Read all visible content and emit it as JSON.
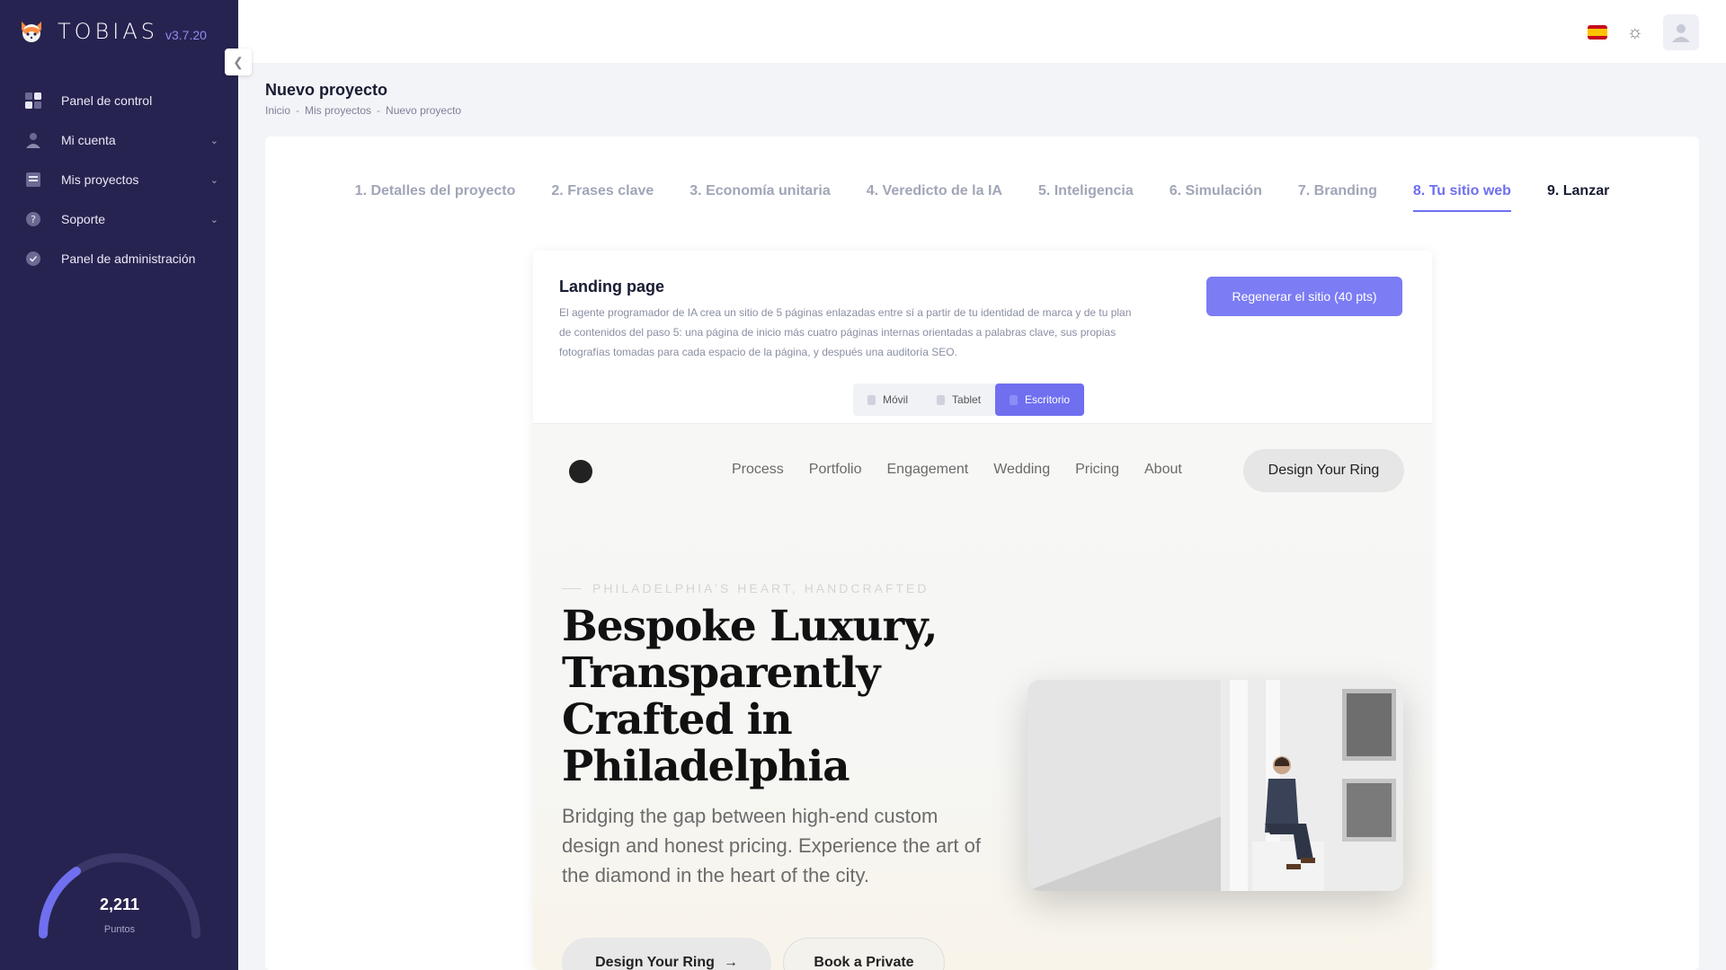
{
  "app": {
    "name": "TOBIAS",
    "version": "v3.7.20"
  },
  "sidebar": {
    "items": [
      {
        "label": "Panel de control",
        "icon": "dashboard-icon",
        "expandable": false
      },
      {
        "label": "Mi cuenta",
        "icon": "user-icon",
        "expandable": true
      },
      {
        "label": "Mis proyectos",
        "icon": "projects-icon",
        "expandable": true
      },
      {
        "label": "Soporte",
        "icon": "help-icon",
        "expandable": true
      },
      {
        "label": "Panel de administración",
        "icon": "shield-icon",
        "expandable": false
      }
    ],
    "points": {
      "value": "2,211",
      "label": "Puntos",
      "fill_fraction": 0.3
    }
  },
  "topbar": {
    "language": "es",
    "theme_icon": "sun-icon",
    "user_icon": "user-avatar-icon"
  },
  "page": {
    "title": "Nuevo proyecto",
    "breadcrumb": [
      "Inicio",
      "Mis proyectos",
      "Nuevo proyecto"
    ]
  },
  "steps": [
    {
      "label": "1. Detalles del proyecto",
      "state": "done"
    },
    {
      "label": "2. Frases clave",
      "state": "done"
    },
    {
      "label": "3. Economía unitaria",
      "state": "done"
    },
    {
      "label": "4. Veredicto de la IA",
      "state": "done"
    },
    {
      "label": "5. Inteligencia",
      "state": "done"
    },
    {
      "label": "6. Simulación",
      "state": "done"
    },
    {
      "label": "7. Branding",
      "state": "done"
    },
    {
      "label": "8. Tu sitio web",
      "state": "active"
    },
    {
      "label": "9. Lanzar",
      "state": "next"
    }
  ],
  "landing": {
    "title": "Landing page",
    "description": "El agente programador de IA crea un sitio de 5 páginas enlazadas entre sí a partir de tu identidad de marca y de tu plan de contenidos del paso 5: una página de inicio más cuatro páginas internas orientadas a palabras clave, sus propias fotografías tomadas para cada espacio de la página, y después una auditoría SEO.",
    "regenerate_label": "Regenerar el sitio (40 pts)",
    "devices": [
      "Móvil",
      "Tablet",
      "Escritorio"
    ],
    "active_device": "Escritorio"
  },
  "preview": {
    "nav": [
      "Process",
      "Portfolio",
      "Engagement",
      "Wedding",
      "Pricing",
      "About"
    ],
    "cta": "Design Your Ring",
    "eyebrow": "PHILADELPHIA'S HEART, HANDCRAFTED",
    "headline": "Bespoke Luxury, Transparently Crafted in Philadelphia",
    "subhead": "Bridging the gap between high-end custom design and honest pricing. Experience the art of the diamond in the heart of the city.",
    "button_primary": "Design Your Ring",
    "button_secondary": "Book a Private"
  }
}
